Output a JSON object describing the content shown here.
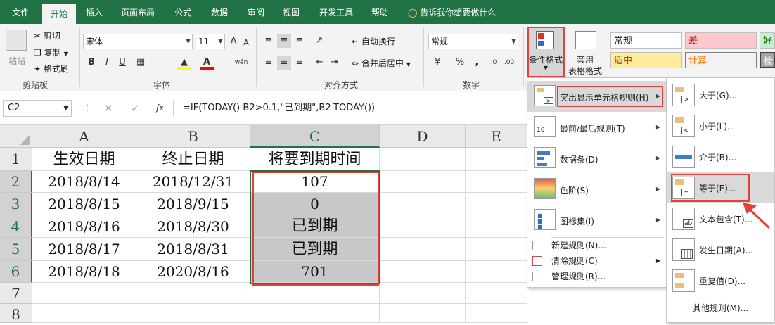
{
  "tabs": [
    "文件",
    "开始",
    "插入",
    "页面布局",
    "公式",
    "数据",
    "审阅",
    "视图",
    "开发工具",
    "帮助"
  ],
  "tellme": "告诉我你想要做什么",
  "clipboard": {
    "paste": "粘贴",
    "cut": "剪切",
    "copy": "复制",
    "painter": "格式刷",
    "group": "剪贴板"
  },
  "font": {
    "name": "宋体",
    "size": "11",
    "bold": "B",
    "italic": "I",
    "underline": "U",
    "group": "字体",
    "inc": "A",
    "dec": "A",
    "wen": "wén"
  },
  "align": {
    "wrap": "自动换行",
    "merge": "合并后居中",
    "group": "对齐方式"
  },
  "number": {
    "format": "常规",
    "pct": "%",
    "comma": ",",
    "group": "数字"
  },
  "styles": {
    "cond": "条件格式",
    "table1": "套用",
    "table2": "表格格式",
    "s1": "常规",
    "s2": "差",
    "s3": "好",
    "s4": "适中",
    "s5": "计算",
    "s6": "检"
  },
  "formulabar": {
    "namebox": "C2",
    "fx": "fx",
    "formula": "=IF(TODAY()-B2>0.1,\"已到期\",B2-TODAY())"
  },
  "columns": [
    "A",
    "B",
    "C",
    "D",
    "E"
  ],
  "rows": [
    "1",
    "2",
    "3",
    "4",
    "5",
    "6",
    "7",
    "8"
  ],
  "table": {
    "headers": [
      "生效日期",
      "终止日期",
      "将要到期时间"
    ],
    "data": [
      [
        "2018/8/14",
        "2018/12/31",
        "107"
      ],
      [
        "2018/8/15",
        "2018/9/15",
        "0"
      ],
      [
        "2018/8/16",
        "2018/8/30",
        "已到期"
      ],
      [
        "2018/8/17",
        "2018/8/31",
        "已到期"
      ],
      [
        "2018/8/18",
        "2020/8/16",
        "701"
      ]
    ]
  },
  "menu1": {
    "items": [
      "突出显示单元格规则(H)",
      "最前/最后规则(T)",
      "数据条(D)",
      "色阶(S)",
      "图标集(I)"
    ],
    "small": [
      "新建规则(N)...",
      "清除规则(C)",
      "管理规则(R)..."
    ]
  },
  "menu2": {
    "items": [
      "大于(G)...",
      "小于(L)...",
      "介于(B)...",
      "等于(E)...",
      "文本包含(T)...",
      "发生日期(A)...",
      "重复值(D)..."
    ],
    "more": "其他规则(M)..."
  },
  "colors": {
    "accent": "#217346",
    "highlight_red": "#e0413a",
    "bad": "#ffc7ce",
    "neutral": "#ffeb9c",
    "good": "#c6efce"
  }
}
